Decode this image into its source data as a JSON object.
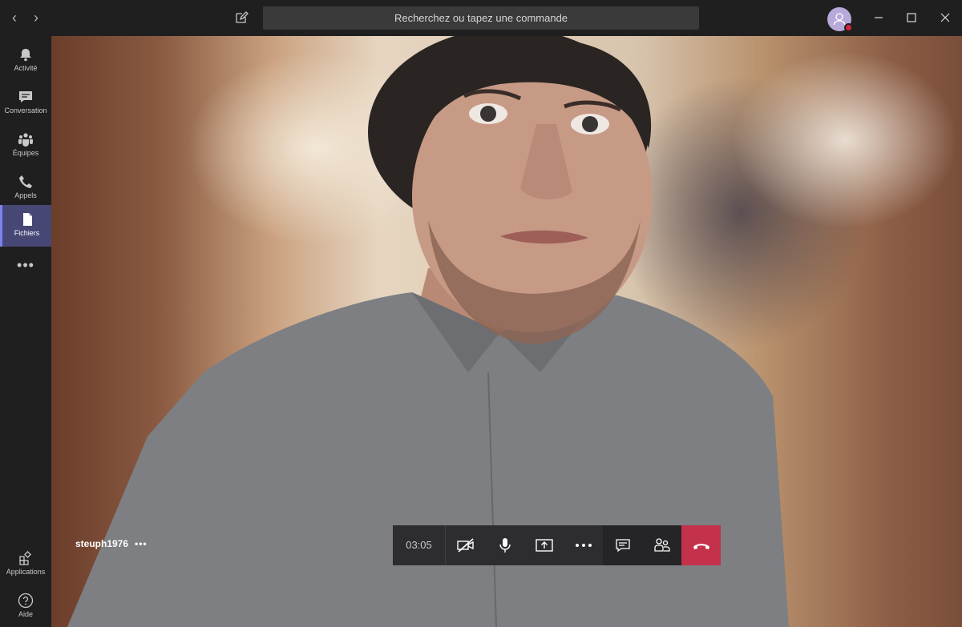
{
  "titlebar": {
    "search_placeholder": "Recherchez ou tapez une commande",
    "back": "‹",
    "forward": "›"
  },
  "rail": {
    "items": [
      {
        "label": "Activité",
        "icon": "bell-icon"
      },
      {
        "label": "Conversation",
        "icon": "chat-icon"
      },
      {
        "label": "Équipes",
        "icon": "teams-icon"
      },
      {
        "label": "Appels",
        "icon": "phone-icon"
      },
      {
        "label": "Fichiers",
        "icon": "file-icon",
        "active": true
      }
    ],
    "more": "•••",
    "bottom": [
      {
        "label": "Applications",
        "icon": "apps-icon"
      },
      {
        "label": "Aide",
        "icon": "help-icon"
      }
    ]
  },
  "call": {
    "participant_name": "steuph1976",
    "participant_more": "•••",
    "timer": "03:05"
  },
  "colors": {
    "accent": "#464775",
    "hangup": "#c4314b",
    "presence_busy": "#d1253d"
  }
}
